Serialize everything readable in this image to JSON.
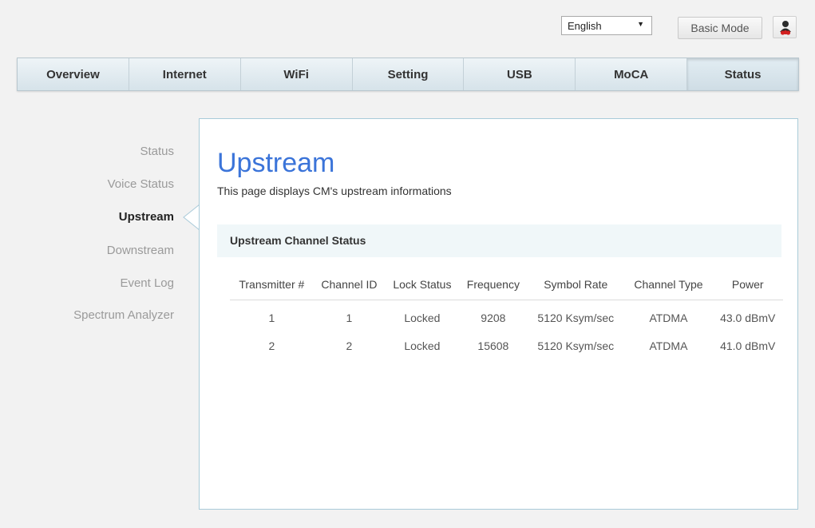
{
  "header": {
    "language": {
      "selected": "English"
    },
    "basic_mode_label": "Basic Mode",
    "user_icon": "user-icon"
  },
  "tabs": [
    {
      "label": "Overview"
    },
    {
      "label": "Internet"
    },
    {
      "label": "WiFi"
    },
    {
      "label": "Setting"
    },
    {
      "label": "USB"
    },
    {
      "label": "MoCA"
    },
    {
      "label": "Status",
      "active": true
    }
  ],
  "sidebar": {
    "items": [
      {
        "label": "Status"
      },
      {
        "label": "Voice Status"
      },
      {
        "label": "Upstream",
        "active": true
      },
      {
        "label": "Downstream"
      },
      {
        "label": "Event Log"
      },
      {
        "label": "Spectrum Analyzer"
      }
    ]
  },
  "main": {
    "title": "Upstream",
    "description": "This page displays CM's upstream informations",
    "section_title": "Upstream Channel Status",
    "table": {
      "columns": [
        "Transmitter #",
        "Channel ID",
        "Lock Status",
        "Frequency",
        "Symbol Rate",
        "Channel Type",
        "Power"
      ],
      "rows": [
        [
          "1",
          "1",
          "Locked",
          "9208",
          "5120 Ksym/sec",
          "ATDMA",
          "43.0 dBmV"
        ],
        [
          "2",
          "2",
          "Locked",
          "15608",
          "5120 Ksym/sec",
          "ATDMA",
          "41.0 dBmV"
        ]
      ]
    }
  },
  "colors": {
    "accent": "#3b74d9",
    "panel_border": "#a9cbd9",
    "section_bg": "#f0f7f9"
  }
}
